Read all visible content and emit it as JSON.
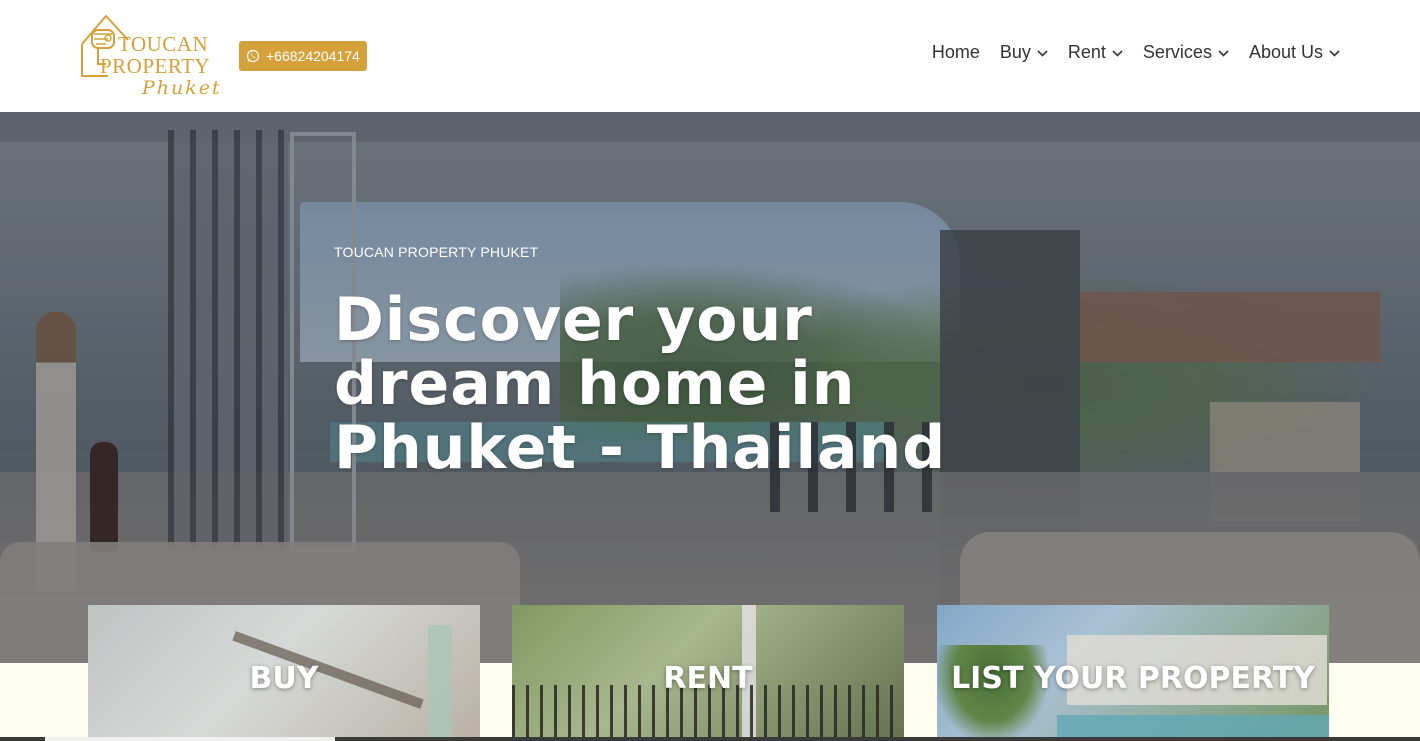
{
  "header": {
    "logo": {
      "line1": "TOUCAN",
      "line2": "PROPERTY",
      "line3": "Phuket"
    },
    "phone": {
      "icon": "whatsapp-icon",
      "label": "+66824204174"
    },
    "nav": [
      {
        "label": "Home",
        "has_dropdown": false
      },
      {
        "label": "Buy",
        "has_dropdown": true
      },
      {
        "label": "Rent",
        "has_dropdown": true
      },
      {
        "label": "Services",
        "has_dropdown": true
      },
      {
        "label": "About Us",
        "has_dropdown": true
      }
    ]
  },
  "hero": {
    "eyebrow": "TOUCAN PROPERTY PHUKET",
    "title": "Discover your dream home in Phuket - Thailand"
  },
  "cards": [
    {
      "label": "BUY"
    },
    {
      "label": "RENT"
    },
    {
      "label": "LIST YOUR PROPERTY"
    }
  ],
  "colors": {
    "brand_gold": "#d4a13a",
    "nav_text": "#333333",
    "page_bg": "#fffdf0"
  }
}
